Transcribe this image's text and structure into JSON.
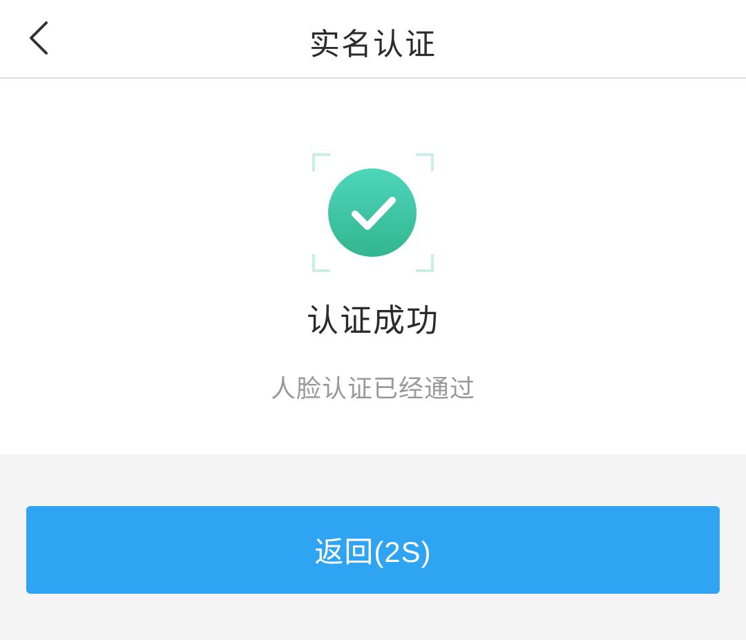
{
  "header": {
    "title": "实名认证",
    "back_icon": "chevron-left-icon"
  },
  "result": {
    "icon": "check-circle-icon",
    "title": "认证成功",
    "description": "人脸认证已经通过"
  },
  "footer": {
    "return_label": "返回(2S)"
  },
  "colors": {
    "accent": "#2ea4f2",
    "success": "#3cc4a4",
    "background": "#f4f4f4"
  }
}
